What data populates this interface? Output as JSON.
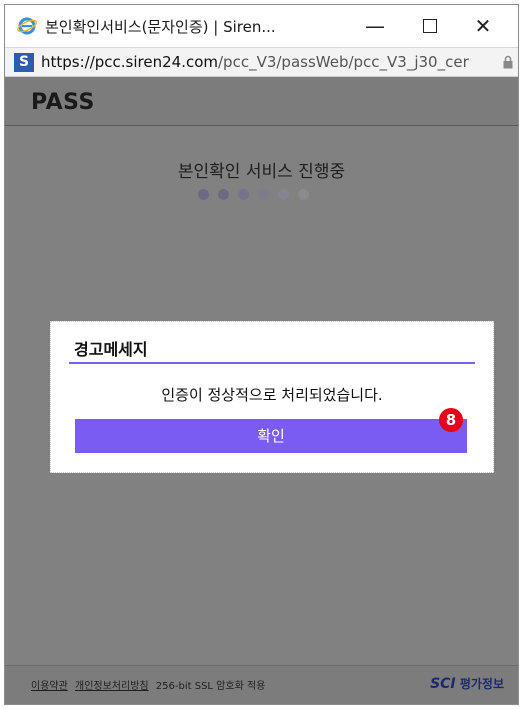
{
  "window": {
    "title": "본인확인서비스(문자인증) | Siren...",
    "url_host": "https://pcc.siren24.com",
    "url_path": "/pcc_V3/passWeb/pcc_V3_j30_cer"
  },
  "header": {
    "logo": "PASS"
  },
  "progress": {
    "text": "본인확인 서비스 진행중",
    "dot_colors": [
      "#6e6a86",
      "#6e6a86",
      "#77738d",
      "#7d7b8d",
      "#858490",
      "#8b8b8f"
    ]
  },
  "dialog": {
    "title": "경고메세지",
    "message": "인증이 정상적으로 처리되었습니다.",
    "confirm_label": "확인",
    "badge": "8"
  },
  "footer": {
    "terms": "이용약관",
    "privacy": "개인정보처리방침",
    "ssl": "256-bit SSL 암호화 적용",
    "brand_sci": "SCI",
    "brand_text": "평가정보"
  },
  "colors": {
    "accent": "#7b5cf3",
    "overlay": "#818181",
    "badge": "#e8001a"
  }
}
